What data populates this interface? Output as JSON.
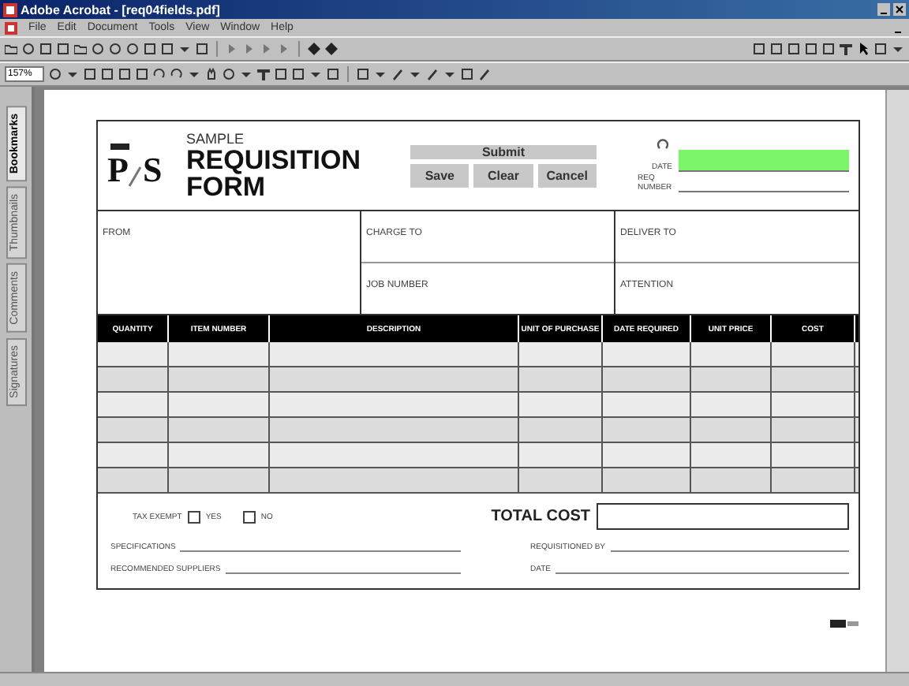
{
  "window": {
    "title": "Adobe Acrobat - [req04fields.pdf]"
  },
  "menu": [
    "File",
    "Edit",
    "Document",
    "Tools",
    "View",
    "Window",
    "Help"
  ],
  "zoom_field": {
    "value": "157%"
  },
  "side_tabs": [
    {
      "label": "Bookmarks",
      "selected": true
    },
    {
      "label": "Thumbnails",
      "selected": false
    },
    {
      "label": "Comments",
      "selected": false
    },
    {
      "label": "Signatures",
      "selected": false
    }
  ],
  "form": {
    "logo": {
      "left": "P",
      "right": "S"
    },
    "title": {
      "small": "SAMPLE",
      "line1": "REQUISITION",
      "line2": "FORM"
    },
    "buttons": [
      {
        "label": "Submit",
        "kind": "wide"
      },
      {
        "label": "Save",
        "kind": "small"
      },
      {
        "label": "Clear",
        "kind": "small"
      },
      {
        "label": "Cancel",
        "kind": "small"
      }
    ],
    "date_label": "DATE",
    "date_highlighted": true,
    "req_label": "REQ NUMBER",
    "sections": [
      {
        "label": "FROM",
        "kind": "tall"
      },
      {
        "label": "CHARGE TO",
        "kind": "half"
      },
      {
        "label": "JOB NUMBER",
        "kind": "half"
      },
      {
        "label": "DELIVER TO",
        "kind": "half"
      },
      {
        "label": "ATTENTION",
        "kind": "half"
      }
    ],
    "columns": [
      "QUANTITY",
      "ITEM NUMBER",
      "DESCRIPTION",
      "UNIT OF PURCHASE",
      "DATE REQUIRED",
      "UNIT PRICE",
      "COST"
    ],
    "tax_exempt": {
      "label": "TAX EXEMPT",
      "options": [
        {
          "label": "YES",
          "checked": false
        },
        {
          "label": "NO",
          "checked": false
        }
      ]
    },
    "total_cost_label": "TOTAL COST",
    "lines": [
      {
        "label": "SPECIFICATIONS"
      },
      {
        "label": "REQUISITIONED BY"
      },
      {
        "label": "RECOMMENDED SUPPLIERS"
      },
      {
        "label": "DATE"
      }
    ]
  }
}
